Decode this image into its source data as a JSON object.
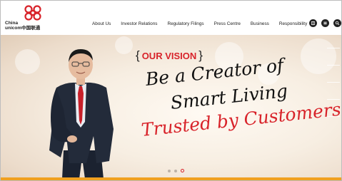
{
  "logo": {
    "line1": "China",
    "line2": "unicom中国联通",
    "brand_color": "#d8232a"
  },
  "nav": {
    "items": [
      {
        "label": "About Us"
      },
      {
        "label": "Investor Relations"
      },
      {
        "label": "Regulatory Filings"
      },
      {
        "label": "Press Centre"
      },
      {
        "label": "Business"
      },
      {
        "label": "Responsibility"
      }
    ]
  },
  "header_icons": [
    "chinese-language-icon",
    "menu-icon",
    "search-icon"
  ],
  "hero": {
    "vision_label": "OUR VISION",
    "bracket_open": "{",
    "bracket_close": "}",
    "line1": "Be a Creator of",
    "line2": "Smart Living",
    "line3": "Trusted by Customers",
    "accent_color": "#d8232a",
    "slide_count": 3,
    "active_slide": 3
  },
  "colors": {
    "bottom_bar": "#f0a020"
  }
}
